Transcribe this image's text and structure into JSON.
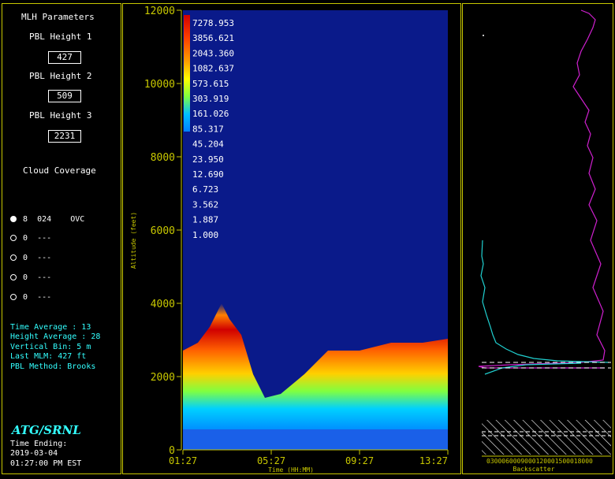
{
  "left": {
    "title": "MLH Parameters",
    "pbl": [
      {
        "label": "PBL Height 1",
        "value": "427"
      },
      {
        "label": "PBL Height 2",
        "value": "509"
      },
      {
        "label": "PBL Height 3",
        "value": "2231"
      }
    ],
    "cloud_title": "Cloud Coverage",
    "cloud_rows": [
      {
        "state": "filled",
        "num": "8",
        "code": "024",
        "cover": "OVC"
      },
      {
        "state": "empty",
        "num": "0",
        "code": "---",
        "cover": ""
      },
      {
        "state": "empty",
        "num": "0",
        "code": "---",
        "cover": ""
      },
      {
        "state": "empty",
        "num": "0",
        "code": "---",
        "cover": ""
      },
      {
        "state": "empty",
        "num": "0",
        "code": "---",
        "cover": ""
      }
    ],
    "info": {
      "time_average": "Time Average : 13",
      "height_average": "Height Average : 28",
      "vertical_bin": "Vertical Bin: 5 m",
      "last_mlm": "Last MLM: 427 ft",
      "pbl_method": "PBL Method: Brooks"
    },
    "brand": "ATG/SRNL",
    "time_ending_label": "Time Ending:",
    "date": "2019-03-04",
    "time": "01:27:00 PM EST"
  },
  "chart_data": [
    {
      "type": "heatmap",
      "title": "",
      "xlabel": "Time (HH:MM)",
      "ylabel": "Altitude (feet)",
      "x_ticks": [
        "01:27",
        "05:27",
        "09:27",
        "13:27"
      ],
      "y_ticks": [
        0,
        2000,
        4000,
        6000,
        8000,
        10000,
        12000
      ],
      "ylim": [
        0,
        12000
      ],
      "colorbar_values": [
        "7278.953",
        "3856.621",
        "2043.360",
        "1082.637",
        "573.615",
        "303.919",
        "161.026",
        "85.317",
        "45.204",
        "23.950",
        "12.690",
        "6.723",
        "3.562",
        "1.887",
        "1.000"
      ],
      "colorbar_colors": [
        "#d00000",
        "#ff3000",
        "#ff8000",
        "#ffc000",
        "#ffff00",
        "#80ff40",
        "#00c0ff",
        "#1040c8"
      ]
    },
    {
      "type": "line",
      "title": "",
      "xlabel": "Backscatter",
      "x_tick_text": "0300060009000120001500018000",
      "ylim": [
        0,
        12000
      ]
    }
  ]
}
